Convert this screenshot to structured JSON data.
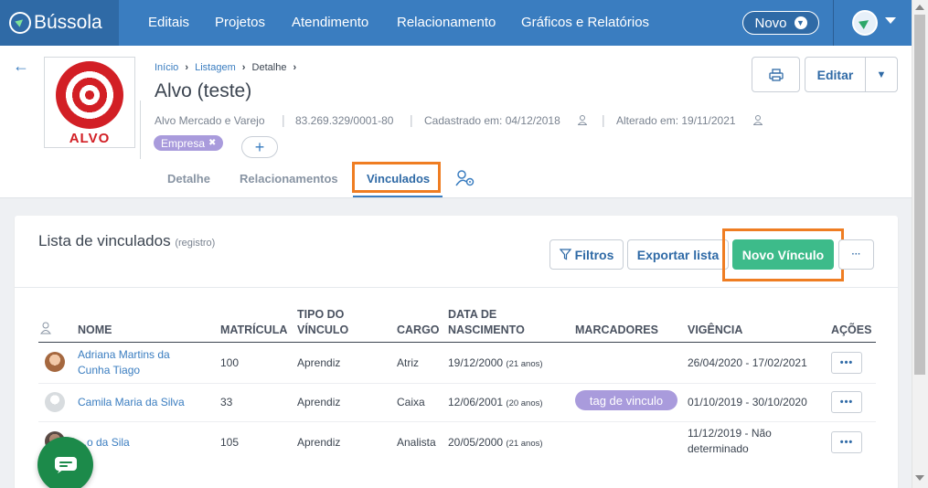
{
  "app": {
    "brand": "Bússola"
  },
  "nav": {
    "items": [
      "Editais",
      "Projetos",
      "Atendimento",
      "Relacionamento",
      "Gráficos e Relatórios"
    ],
    "novo_label": "Novo"
  },
  "breadcrumb": {
    "items": [
      "Início",
      "Listagem",
      "Detalhe"
    ]
  },
  "entity": {
    "logo_text": "ALVO",
    "title": "Alvo (teste)",
    "segment": "Alvo Mercado e Varejo",
    "cnpj": "83.269.329/0001-80",
    "created": "Cadastrado em: 04/12/2018",
    "updated": "Alterado em: 19/11/2021",
    "tag": "Empresa",
    "tag_remove": "✖",
    "add_tag": "+"
  },
  "header_actions": {
    "edit_label": "Editar"
  },
  "tabs": [
    "Detalhe",
    "Relacionamentos",
    "Vinculados"
  ],
  "list": {
    "title": "Lista de vinculados",
    "subtitle": "(registro)",
    "filters_label": "Filtros",
    "export_label": "Exportar lista",
    "new_label": "Novo Vínculo",
    "more_label": "···"
  },
  "table": {
    "headers": {
      "name": "NOME",
      "registration": "MATRÍCULA",
      "type_line1": "TIPO DO",
      "type_line2": "VÍNCULO",
      "role": "CARGO",
      "birth_line1": "DATA DE",
      "birth_line2": "NASCIMENTO",
      "markers": "MARCADORES",
      "validity": "VIGÊNCIA",
      "actions": "AÇÕES"
    },
    "rows": [
      {
        "name_line1": "Adriana Martins da",
        "name_line2": "Cunha Tiago",
        "registration": "100",
        "type": "Aprendiz",
        "role": "Atriz",
        "birth": "19/12/2000",
        "age": "(21 anos)",
        "marker": "",
        "validity_line1": "26/04/2020 - 17/02/2021",
        "validity_line2": "",
        "action": "•••"
      },
      {
        "name_line1": "Camila Maria da Silva",
        "name_line2": "",
        "registration": "33",
        "type": "Aprendiz",
        "role": "Caixa",
        "birth": "12/06/2001",
        "age": "(20 anos)",
        "marker": "tag de vinculo",
        "validity_line1": "01/10/2019 - 30/10/2020",
        "validity_line2": "",
        "action": "•••"
      },
      {
        "name_line1": "...o da Sila",
        "name_line2": "",
        "registration": "105",
        "type": "Aprendiz",
        "role": "Analista",
        "birth": "20/05/2000",
        "age": "(21 anos)",
        "marker": "",
        "validity_line1": "11/12/2019 - Não",
        "validity_line2": "determinado",
        "action": "•••"
      }
    ]
  },
  "colors": {
    "nav_bg": "#3a7dc0",
    "brand_bg": "#2f6aa6",
    "accent_green": "#3dbb8a",
    "tag_purple": "#a99bdc",
    "highlight_orange": "#ef7d22",
    "logo_red": "#d21f25"
  }
}
